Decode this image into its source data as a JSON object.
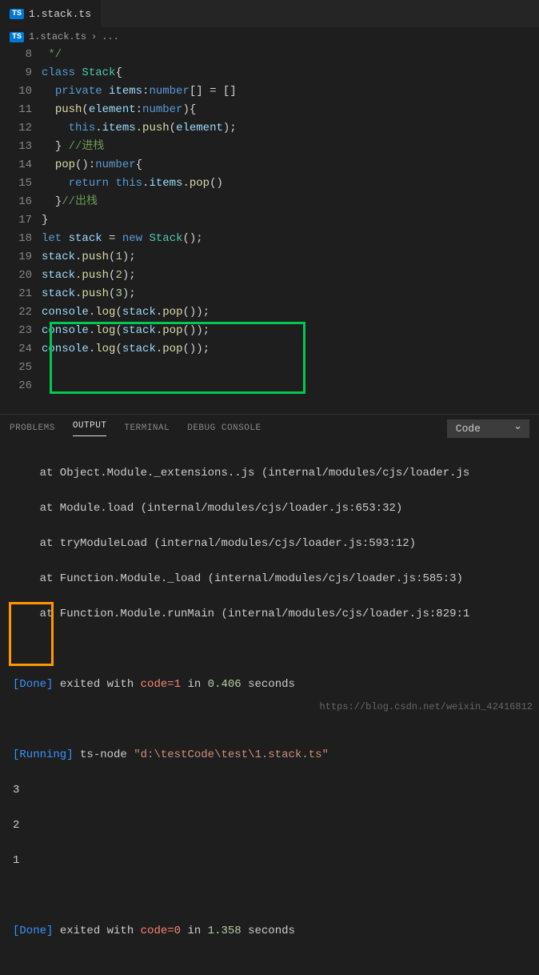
{
  "tab": {
    "icon_label": "TS",
    "filename": "1.stack.ts"
  },
  "breadcrumb": {
    "icon_label": "TS",
    "filename": "1.stack.ts",
    "sep": "›",
    "dots": "..."
  },
  "gutter": {
    "start": 8,
    "end": 26
  },
  "code": {
    "l8": " */",
    "l9": {
      "kw1": "class",
      "cls": "Stack",
      "p": "{"
    },
    "l10": {
      "kw1": "private",
      "var": "items",
      "p1": ":",
      "kw2": "number",
      "p2": "[] = []"
    },
    "l11": {
      "fn": "push",
      "p1": "(",
      "var": "element",
      "p2": ":",
      "kw": "number",
      "p3": "){"
    },
    "l12": {
      "kw": "this",
      "p1": ".",
      "var1": "items",
      "p2": ".",
      "fn": "push",
      "p3": "(",
      "var2": "element",
      "p4": ");"
    },
    "l13": {
      "p": "} ",
      "cmt": "//进栈"
    },
    "l14": {
      "fn": "pop",
      "p1": "():",
      "kw": "number",
      "p2": "{"
    },
    "l15": {
      "kw1": "return",
      "kw2": "this",
      "p1": ".",
      "var": "items",
      "p2": ".",
      "fn": "pop",
      "p3": "()"
    },
    "l16": {
      "p": "}",
      "cmt": "//出栈"
    },
    "l17": {
      "p": "}"
    },
    "l18": {
      "kw1": "let",
      "var": "stack",
      "p1": " = ",
      "kw2": "new",
      "cls": "Stack",
      "p2": "();"
    },
    "l19": {
      "var": "stack",
      "p1": ".",
      "fn": "push",
      "p2": "(",
      "num": "1",
      "p3": ");"
    },
    "l20": {
      "var": "stack",
      "p1": ".",
      "fn": "push",
      "p2": "(",
      "num": "2",
      "p3": ");"
    },
    "l21": {
      "var": "stack",
      "p1": ".",
      "fn": "push",
      "p2": "(",
      "num": "3",
      "p3": ");"
    },
    "l22": {
      "var1": "console",
      "p1": ".",
      "fn1": "log",
      "p2": "(",
      "var2": "stack",
      "p3": ".",
      "fn2": "pop",
      "p4": "());"
    },
    "l23": {
      "var1": "console",
      "p1": ".",
      "fn1": "log",
      "p2": "(",
      "var2": "stack",
      "p3": ".",
      "fn2": "pop",
      "p4": "());"
    },
    "l24": {
      "var1": "console",
      "p1": ".",
      "fn1": "log",
      "p2": "(",
      "var2": "stack",
      "p3": ".",
      "fn2": "pop",
      "p4": "());"
    }
  },
  "panel": {
    "tabs": {
      "problems": "PROBLEMS",
      "output": "OUTPUT",
      "terminal": "TERMINAL",
      "debug": "DEBUG CONSOLE"
    },
    "select": "Code"
  },
  "output": {
    "trace1": "    at Object.Module._extensions..js (internal/modules/cjs/loader.js",
    "trace2": "    at Module.load (internal/modules/cjs/loader.js:653:32)",
    "trace3": "    at tryModuleLoad (internal/modules/cjs/loader.js:593:12)",
    "trace4": "    at Function.Module._load (internal/modules/cjs/loader.js:585:3)",
    "trace5": "    at Function.Module.runMain (internal/modules/cjs/loader.js:829:1",
    "done1_a": "[Done]",
    "done1_b": " exited with ",
    "done1_c": "code=1",
    "done1_d": " in ",
    "done1_e": "0.406",
    "done1_f": " seconds",
    "run_a": "[Running]",
    "run_b": " ts-node ",
    "run_c": "\"d:\\testCode\\test\\1.stack.ts\"",
    "r1": "3",
    "r2": "2",
    "r3": "1",
    "done2_a": "[Done]",
    "done2_b": " exited with ",
    "done2_c": "code=0",
    "done2_d": " in ",
    "done2_e": "1.358",
    "done2_f": " seconds"
  },
  "watermark": "https://blog.csdn.net/weixin_42416812"
}
